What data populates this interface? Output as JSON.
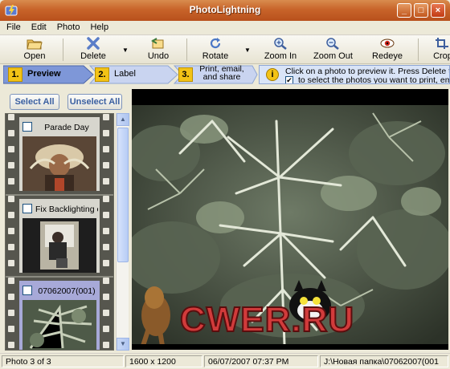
{
  "window": {
    "title": "PhotoLightning"
  },
  "menu": [
    "File",
    "Edit",
    "Photo",
    "Help"
  ],
  "toolbar": {
    "open": "Open",
    "delete": "Delete",
    "undo": "Undo",
    "rotate": "Rotate",
    "zoom_in": "Zoom In",
    "zoom_out": "Zoom Out",
    "redeye": "Redeye",
    "crop": "Crop"
  },
  "steps": [
    {
      "num": "1.",
      "label": "Preview"
    },
    {
      "num": "2.",
      "label": "Label"
    },
    {
      "num": "3.",
      "label": "Print, email, and share"
    }
  ],
  "info": {
    "line1": "Click on a photo to preview it.  Press Delete to",
    "line2": "to select the photos you want to print, em"
  },
  "select_all": "Select All",
  "unselect_all": "Unselect All",
  "film": [
    {
      "name": "Parade Day",
      "checked": false,
      "selected": false
    },
    {
      "name": "Fix Backlighting on",
      "checked": false,
      "selected": false
    },
    {
      "name": "07062007(001)",
      "checked": false,
      "selected": true
    }
  ],
  "preview_watermark": "CWER.RU",
  "status": {
    "count": "Photo 3 of 3",
    "dimensions": "1600 x 1200",
    "datetime": "06/07/2007  07:37 PM",
    "path": "J:\\Новая папка\\07062007(001"
  },
  "colors": {
    "titlebar": "#C8642A",
    "step_active": "#7E97D8",
    "step_inactive": "#C9D4F0",
    "step_number": "#F3C316"
  }
}
